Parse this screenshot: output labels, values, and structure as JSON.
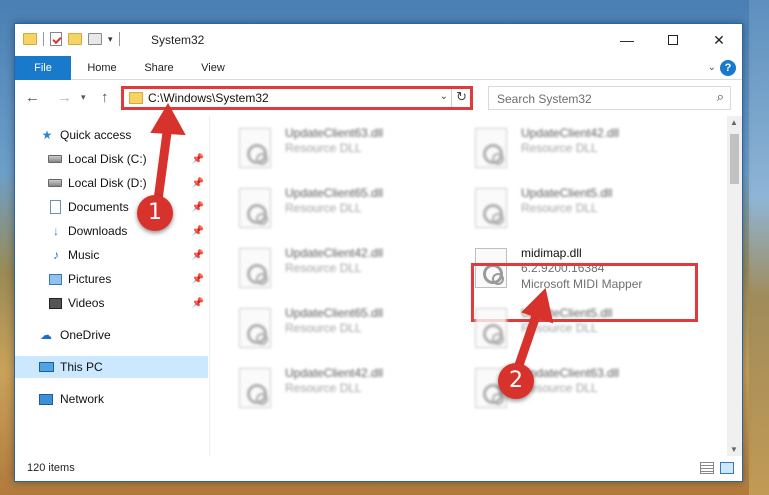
{
  "window": {
    "title": "System32"
  },
  "ribbon": {
    "tabs": [
      "File",
      "Home",
      "Share",
      "View"
    ],
    "help": "?"
  },
  "nav": {
    "address": "C:\\Windows\\System32",
    "search_placeholder": "Search System32"
  },
  "sidebar": {
    "items": [
      {
        "label": "Quick access",
        "icon": "star-icon"
      },
      {
        "label": "Local Disk (C:)",
        "icon": "disk-icon"
      },
      {
        "label": "Local Disk (D:)",
        "icon": "disk-icon"
      },
      {
        "label": "Documents",
        "icon": "document-icon"
      },
      {
        "label": "Downloads",
        "icon": "download-icon"
      },
      {
        "label": "Music",
        "icon": "music-icon"
      },
      {
        "label": "Pictures",
        "icon": "pictures-icon"
      },
      {
        "label": "Videos",
        "icon": "videos-icon"
      },
      {
        "label": "OneDrive",
        "icon": "cloud-icon"
      },
      {
        "label": "This PC",
        "icon": "computer-icon"
      },
      {
        "label": "Network",
        "icon": "network-icon"
      }
    ]
  },
  "files": [
    {
      "name": "UpdateClient63.dll",
      "type": "Resource DLL"
    },
    {
      "name": "UpdateClient42.dll",
      "type": "Resource DLL"
    },
    {
      "name": "UpdateClient65.dll",
      "type": "Resource DLL"
    },
    {
      "name": "UpdateClient5.dll",
      "type": "Resource DLL"
    },
    {
      "name": "UpdateClient42.dll",
      "type": "Resource DLL"
    },
    {
      "name": "UpdateClient65.dll",
      "type": "Resource DLL"
    },
    {
      "name": "UpdateClient5.dll",
      "type": "Resource DLL"
    },
    {
      "name": "UpdateClient42.dll",
      "type": "Resource DLL"
    },
    {
      "name": "UpdateClient63.dll",
      "type": "Resource DLL"
    }
  ],
  "selected_file": {
    "name": "midimap.dll",
    "version": "6.2.9200.16384",
    "description": "Microsoft MIDI Mapper"
  },
  "status": {
    "item_count": "120 items"
  },
  "annotations": {
    "marker1": "1",
    "marker2": "2",
    "color": "#d8322c"
  }
}
